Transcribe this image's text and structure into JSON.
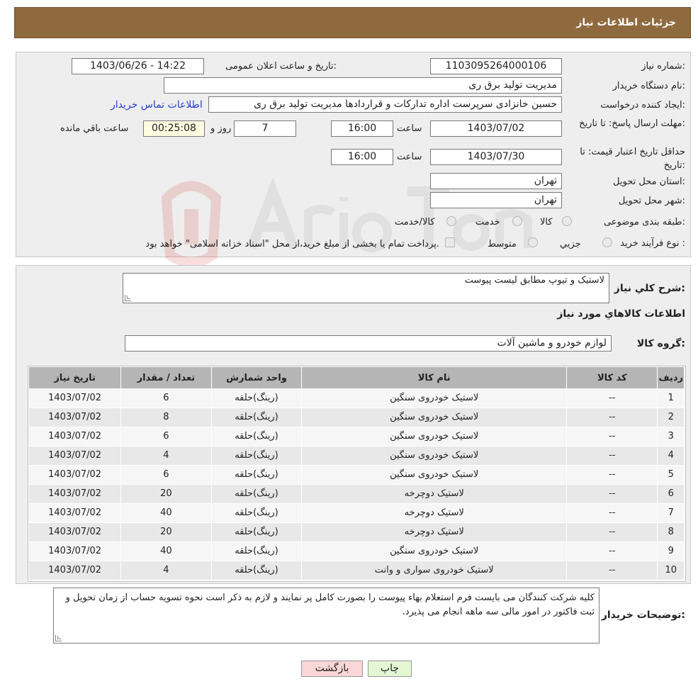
{
  "header": {
    "title": "جزئیات اطلاعات نیاز"
  },
  "form": {
    "need_number_label": "شماره نیاز:",
    "need_number": "1103095264000106",
    "announce_label": "تاریخ و ساعت اعلان عمومی:",
    "announce_value": "1403/06/26 - 14:22",
    "buyer_org_label": "نام دستگاه خریدار:",
    "buyer_org": "مدیریت تولید برق ری",
    "requester_label": "ایجاد کننده درخواست:",
    "requester": "حسین خانزادی سرپرست اداره تداركات و قراردادها مدیریت تولید برق ری",
    "contact_link": "اطلاعات تماس خریدار",
    "deadline_label": "مهلت ارسال پاسخ: تا تاریخ:",
    "deadline_date": "1403/07/02",
    "time_label": "ساعت",
    "deadline_time": "16:00",
    "days_value": "7",
    "days_label": "روز و",
    "remaining_time": "00:25:08",
    "remaining_label": "ساعت باقي مانده",
    "validity_label": "حداقل تاریخ اعتبار قیمت: تا تاریخ:",
    "validity_date": "1403/07/30",
    "validity_time": "16:00",
    "province_label": "استان محل تحویل:",
    "province": "تهران",
    "city_label": "شهر محل تحویل:",
    "city": "تهران",
    "category_label": "طبقه بندی موضوعی:",
    "category_options": [
      "کالا",
      "خدمت",
      "کالا/خدمت"
    ],
    "process_label": "نوع فرآیند خرید :",
    "process_options": [
      "جزيي",
      "متوسط"
    ],
    "process_note": "پرداخت تمام یا بخشی از مبلغ خرید،از محل \"اسناد خزانه اسلامی\" خواهد بود."
  },
  "details": {
    "summary_label": "شرح كلي نياز:",
    "summary": "لاستیک و تیوپ مطابق لیست پیوست",
    "goods_info_title": "اطلاعات كالاهاي مورد نياز",
    "group_label": "گروه كالا:",
    "group_value": "لوازم خودرو و ماشین آلات"
  },
  "table": {
    "headers": [
      "ردیف",
      "کد کالا",
      "نام کالا",
      "واحد شمارش",
      "تعداد / مقدار",
      "تاریخ نیاز"
    ],
    "rows": [
      [
        "1",
        "--",
        "لاستیک خودروی سنگین",
        "(رینگ)حلقه",
        "6",
        "1403/07/02"
      ],
      [
        "2",
        "--",
        "لاستیک خودروی سنگین",
        "(رینگ)حلقه",
        "8",
        "1403/07/02"
      ],
      [
        "3",
        "--",
        "لاستیک خودروی سنگین",
        "(رینگ)حلقه",
        "6",
        "1403/07/02"
      ],
      [
        "4",
        "--",
        "لاستیک خودروی سنگین",
        "(رینگ)حلقه",
        "4",
        "1403/07/02"
      ],
      [
        "5",
        "--",
        "لاستیک خودروی سنگین",
        "(رینگ)حلقه",
        "6",
        "1403/07/02"
      ],
      [
        "6",
        "--",
        "لاستیک دوچرخه",
        "(رینگ)حلقه",
        "20",
        "1403/07/02"
      ],
      [
        "7",
        "--",
        "لاستیک دوچرخه",
        "(رینگ)حلقه",
        "40",
        "1403/07/02"
      ],
      [
        "8",
        "--",
        "لاستیک دوچرخه",
        "(رینگ)حلقه",
        "20",
        "1403/07/02"
      ],
      [
        "9",
        "--",
        "لاستیک خودروی سنگین",
        "(رینگ)حلقه",
        "40",
        "1403/07/02"
      ],
      [
        "10",
        "--",
        "لاستیک خودروی سواری و وانت",
        "(رینگ)حلقه",
        "4",
        "1403/07/02"
      ]
    ]
  },
  "notes": {
    "label": "توضیحات خریدار:",
    "text": "کلیه شرکت کنندگان می بایست فرم استعلام بهاء پیوست را بصورت کامل پر نمایند و لازم به ذکر است نحوه تسویه حساب از زمان تحویل و ثبت فاکتور در امور مالی سه ماهه انجام می پذیرد."
  },
  "buttons": {
    "print": "چاپ",
    "back": "بازگشت"
  },
  "colors": {
    "header_bg": "#8f6a3e",
    "back_button_bg": "#fbd6d6",
    "print_button_bg": "#e4f7d4",
    "remaining_bg": "#fffbe0"
  }
}
